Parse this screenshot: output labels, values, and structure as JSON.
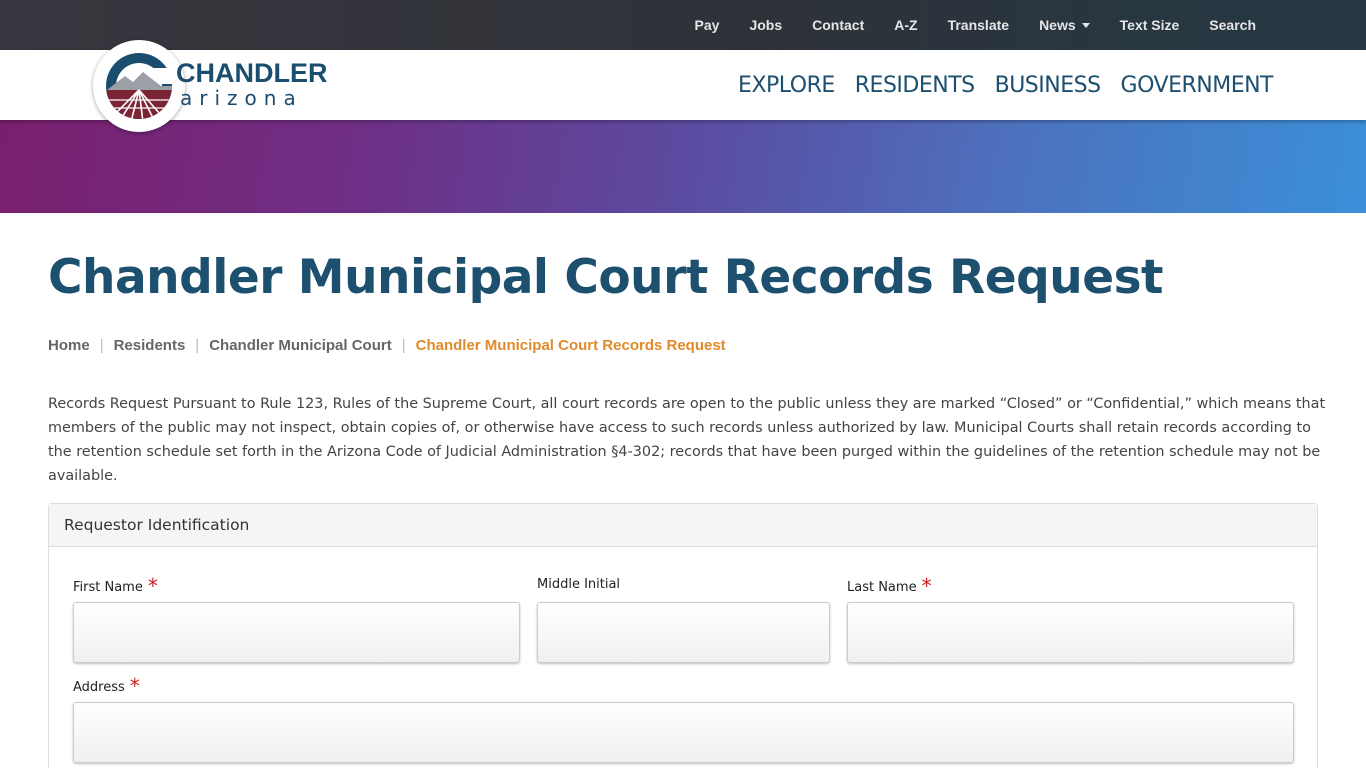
{
  "utility_nav": {
    "items": [
      "Pay",
      "Jobs",
      "Contact",
      "A-Z",
      "Translate",
      "News",
      "Text Size",
      "Search"
    ]
  },
  "logo": {
    "word": "CHANDLER",
    "sub": "arizona",
    "colors": {
      "navy": "#1b4d6f",
      "maroon": "#7a2434"
    }
  },
  "main_nav": {
    "items": [
      "EXPLORE",
      "RESIDENTS",
      "BUSINESS",
      "GOVERNMENT"
    ]
  },
  "page": {
    "title": "Chandler Municipal Court Records Request",
    "breadcrumb": {
      "items": [
        "Home",
        "Residents",
        "Chandler Municipal Court"
      ],
      "separator": "|",
      "current": "Chandler Municipal Court Records Request"
    },
    "intro": "Records Request Pursuant to Rule 123, Rules of the Supreme Court, all court records are open to the public unless they are marked “Closed” or “Confidential,” which means that members of the public may not inspect, obtain copies of, or otherwise have access to such records unless authorized by law. Municipal Courts shall retain records according to the retention schedule set forth in the Arizona Code of Judicial Administration §4-302; records that have been purged within the guidelines of the retention schedule may not be available."
  },
  "form": {
    "panel_title": "Requestor Identification",
    "required_mark": "*",
    "fields": {
      "first_name": {
        "label": "First Name",
        "value": ""
      },
      "middle_initial": {
        "label": "Middle Initial",
        "value": ""
      },
      "last_name": {
        "label": "Last Name",
        "value": ""
      },
      "address": {
        "label": "Address",
        "value": ""
      }
    }
  },
  "colors": {
    "primary_navy": "#1d4f6e",
    "breadcrumb_active": "#e08b2b",
    "required": "#cc1f1f"
  }
}
